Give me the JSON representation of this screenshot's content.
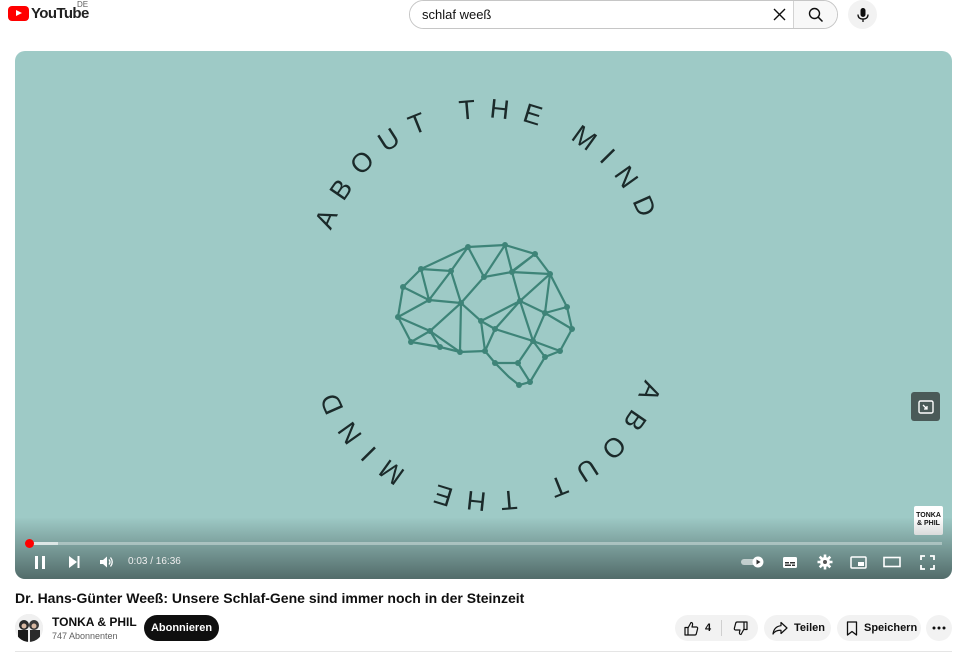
{
  "header": {
    "logo_text": "YouTube",
    "country_code": "DE",
    "search_value": "schlaf weeß",
    "icons": [
      "close-icon",
      "search-icon",
      "microphone-icon"
    ]
  },
  "player": {
    "artwork_text_top": "ABOUT THE MIND",
    "artwork_text_bottom": "ABOUT THE MIND",
    "watermark": "TONKA & PHIL",
    "current_time": "0:03",
    "duration": "16:36",
    "time_display": "0:03 / 16:36",
    "progress_fraction": 0.003,
    "loaded_fraction": 0.035,
    "autoplay_on": true,
    "colors": {
      "background": "#9ecac6",
      "text": "#1b2a2a",
      "brain": "#3e8478",
      "progress": "#ff0000"
    }
  },
  "video": {
    "title": "Dr. Hans-Günter Weeß: Unsere Schlaf-Gene sind immer noch in der Steinzeit",
    "channel_name": "TONKA & PHIL",
    "subscribers": "747 Abonnenten",
    "subscribe_label": "Abonnieren",
    "like_count": "4",
    "share_label": "Teilen",
    "save_label": "Speichern"
  }
}
